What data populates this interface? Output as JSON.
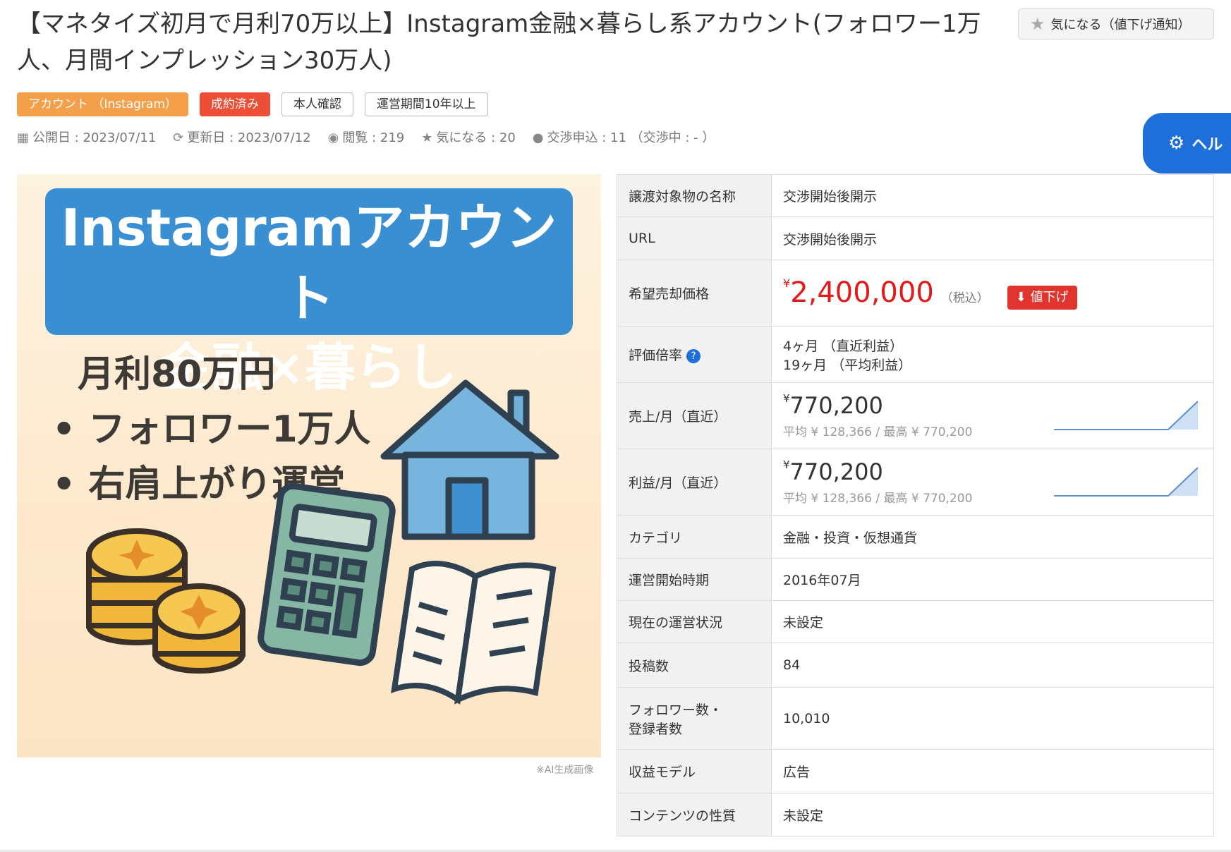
{
  "title": "【マネタイズ初月で月利70万以上】Instagram金融×暮らし系アカウント(フォロワー1万人、月間インプレッション30万人)",
  "favorite_button": {
    "label": "気になる（値下げ通知）",
    "icon": "star-icon"
  },
  "badges": [
    {
      "label": "アカウント （Instagram）",
      "color": "#f4a04b"
    },
    {
      "label": "成約済み",
      "color": "#ee4e35"
    },
    {
      "label": "本人確認"
    },
    {
      "label": "運営期間10年以上"
    }
  ],
  "meta": {
    "published": "公開日 : 2023/07/11",
    "updated": "更新日 : 2023/07/12",
    "views": "閲覧 : 219",
    "favorites": "気になる : 20",
    "negotiations": "交渉申込 : 11 （交渉中 : - ）"
  },
  "help_button": {
    "label": "ヘル",
    "icon": "robot-icon"
  },
  "hero_image": {
    "line1": "Instagramアカウント",
    "line2": "金融×暮らし",
    "bullets": [
      "月利80万円",
      "• フォロワー1万人",
      "• 右肩上がり運営"
    ],
    "note": "※AI生成画像"
  },
  "table": {
    "rows": [
      {
        "key": "譲渡対象物の名称",
        "value": "交渉開始後開示"
      },
      {
        "key": "URL",
        "value": "交渉開始後開示"
      },
      {
        "key": "希望売却価格",
        "currency": "¥",
        "price": "2,400,000",
        "tax": "（税込）",
        "badge": "値下げ"
      },
      {
        "key": "評価倍率",
        "line1": "4ヶ月 （直近利益）",
        "line2": "19ヶ月 （平均利益）"
      },
      {
        "key": "売上/月（直近）",
        "currency": "¥",
        "value": "770,200",
        "sub": "平均 ¥ 128,366 / 最高 ¥ 770,200"
      },
      {
        "key": "利益/月（直近）",
        "currency": "¥",
        "value": "770,200",
        "sub": "平均 ¥ 128,366 / 最高 ¥ 770,200"
      },
      {
        "key": "カテゴリ",
        "value": "金融・投資・仮想通貨"
      },
      {
        "key": "運営開始時期",
        "value": "2016年07月"
      },
      {
        "key": "現在の運営状況",
        "value": "未設定"
      },
      {
        "key": "投稿数",
        "value": "84"
      },
      {
        "key": "フォロワー数・\n登録者数",
        "key_line1": "フォロワー数・",
        "key_line2": "登録者数",
        "value": "10,010"
      },
      {
        "key": "収益モデル",
        "value": "広告"
      },
      {
        "key": "コンテンツの性質",
        "value": "未設定"
      }
    ]
  },
  "colors": {
    "accent": "#1e6fd9",
    "price_red": "#e21a1a",
    "orange": "#f4a04b"
  }
}
